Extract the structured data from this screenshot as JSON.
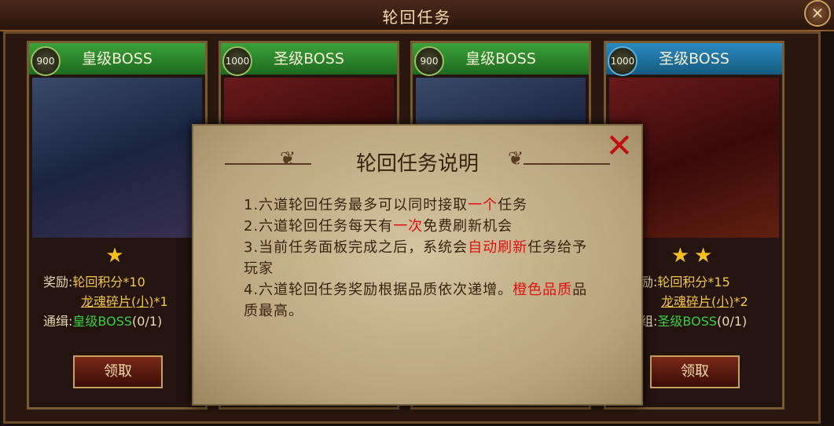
{
  "window": {
    "title": "轮回任务",
    "close_icon": "×"
  },
  "cards": [
    {
      "badge": "900",
      "name": "皇级BOSS",
      "head_color": "green",
      "art": "boss1",
      "stars": "★",
      "reward_label": "奖励:",
      "reward_points": "轮回积分*10",
      "reward_item": "龙魂碎片(小)",
      "reward_item_count": "*1",
      "target_label": "通缉:",
      "target_name": "皇级BOSS",
      "target_progress": "(0/1)",
      "button": "领取"
    },
    {
      "badge": "1000",
      "name": "圣级BOSS",
      "head_color": "green",
      "art": "boss2",
      "stars": "",
      "reward_label": "",
      "reward_points": "",
      "reward_item": "",
      "reward_item_count": "",
      "target_label": "",
      "target_name": "",
      "target_progress": "",
      "button": ""
    },
    {
      "badge": "900",
      "name": "皇级BOSS",
      "head_color": "green",
      "art": "boss1",
      "stars": "",
      "reward_label": "",
      "reward_points": "",
      "reward_item": "",
      "reward_item_count": "",
      "target_label": "",
      "target_name": "",
      "target_progress": "",
      "button": ""
    },
    {
      "badge": "1000",
      "name": "圣级BOSS",
      "head_color": "blue",
      "art": "boss2",
      "stars": "★★",
      "reward_label": "励:",
      "reward_points": "轮回积分*15",
      "reward_item": "龙魂碎片(小)",
      "reward_item_count": "*2",
      "target_label": "组:",
      "target_name": "圣级BOSS",
      "target_progress": "(0/1)",
      "button": "领取"
    }
  ],
  "modal": {
    "title": "轮回任务说明",
    "close_icon": "✕",
    "line1_a": "1.六道轮回任务最多可以同时接取",
    "line1_b": "一个",
    "line1_c": "任务",
    "line2_a": "2.六道轮回任务每天有",
    "line2_b": "一次",
    "line2_c": "免费刷新机会",
    "line3_a": "3.当前任务面板完成之后，系统会",
    "line3_b": "自动刷新",
    "line3_c": "任务给予玩家",
    "line4_a": "4.六道轮回任务奖励根据品质依次递增。",
    "line4_b": "橙色品质",
    "line4_c": "品质最高。"
  }
}
